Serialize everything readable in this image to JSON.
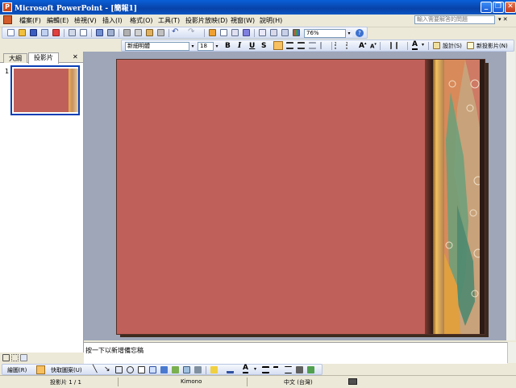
{
  "window": {
    "title": "Microsoft PowerPoint - [簡報1]",
    "minimize": "_",
    "restore": "❐",
    "close": "✕"
  },
  "menu": {
    "items": [
      "檔案(F)",
      "編輯(E)",
      "檢視(V)",
      "插入(I)",
      "格式(O)",
      "工具(T)",
      "投影片放映(D)",
      "視窗(W)",
      "說明(H)"
    ],
    "help_placeholder": "輸入需要解答的問題"
  },
  "standard_toolbar": {
    "zoom_value": "76%"
  },
  "formatting_toolbar": {
    "font_value": "新細明體",
    "size_value": "18",
    "bold": "B",
    "italic": "I",
    "underline": "U",
    "shadow": "S",
    "font_color_glyph": "A",
    "design_label": "設計(S)",
    "new_slide_label": "新投影片(N)"
  },
  "left_pane": {
    "tabs": [
      "大綱",
      "投影片"
    ],
    "close": "✕",
    "thumbnail_number": "1"
  },
  "notes": {
    "placeholder": "按一下以新增備忘稿"
  },
  "drawing_toolbar": {
    "draw_label": "繪圖(R)",
    "autoshape_label": "快取圖案(U)"
  },
  "status_bar": {
    "slide_info": "投影片 1 / 1",
    "template": "Kimono",
    "language": "中文 (台灣)"
  },
  "colors": {
    "slide_background": "#c0605a",
    "workspace": "#9ea6b8",
    "title_bar": "#0a56c4"
  }
}
